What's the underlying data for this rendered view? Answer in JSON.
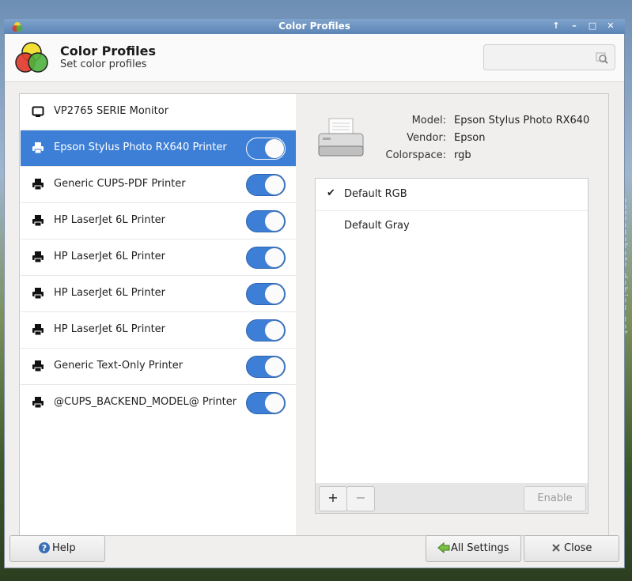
{
  "window": {
    "title": "Color Profiles"
  },
  "header": {
    "title": "Color Profiles",
    "subtitle": "Set color profiles",
    "search_placeholder": ""
  },
  "devices": [
    {
      "label": "VP2765 SERIE Monitor",
      "icon": "monitor-icon",
      "selected": false,
      "toggle": null
    },
    {
      "label": "Epson Stylus Photo RX640 Printer",
      "icon": "printer-icon",
      "selected": true,
      "toggle": true
    },
    {
      "label": "Generic CUPS-PDF Printer",
      "icon": "printer-icon",
      "selected": false,
      "toggle": true
    },
    {
      "label": "HP LaserJet 6L Printer",
      "icon": "printer-icon",
      "selected": false,
      "toggle": true
    },
    {
      "label": "HP LaserJet 6L Printer",
      "icon": "printer-icon",
      "selected": false,
      "toggle": true
    },
    {
      "label": "HP LaserJet 6L Printer",
      "icon": "printer-icon",
      "selected": false,
      "toggle": true
    },
    {
      "label": "HP LaserJet 6L Printer",
      "icon": "printer-icon",
      "selected": false,
      "toggle": true
    },
    {
      "label": "Generic Text-Only Printer",
      "icon": "printer-icon",
      "selected": false,
      "toggle": true
    },
    {
      "label": "@CUPS_BACKEND_MODEL@ Printer",
      "icon": "printer-icon",
      "selected": false,
      "toggle": true
    }
  ],
  "details": {
    "model_key": "Model:",
    "model_val": "Epson Stylus Photo RX640",
    "vendor_key": "Vendor:",
    "vendor_val": "Epson",
    "colorspace_key": "Colorspace:",
    "colorspace_val": "rgb"
  },
  "profiles": [
    {
      "label": "Default RGB",
      "checked": true,
      "mark": "✔"
    },
    {
      "label": "Default Gray",
      "checked": false,
      "mark": ""
    }
  ],
  "profile_toolbar": {
    "add_label": "+",
    "remove_label": "−",
    "enable_label": "Enable"
  },
  "buttons": {
    "help_label": "Help",
    "all_settings_label": "All Settings",
    "close_label": "Close"
  },
  "watermark": "screenshots.debian.net",
  "colors": {
    "accent": "#3d7fd6",
    "titlebar": "#5b84b5"
  }
}
